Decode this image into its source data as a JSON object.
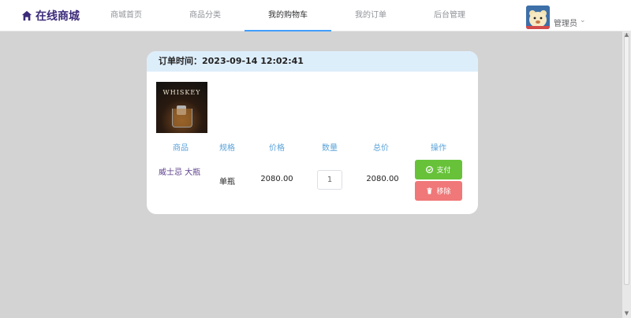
{
  "brand": {
    "name": "在线商城",
    "icon": "home-icon"
  },
  "nav": {
    "items": [
      {
        "label": "商城首页",
        "active": false
      },
      {
        "label": "商品分类",
        "active": false
      },
      {
        "label": "我的购物车",
        "active": true
      },
      {
        "label": "我的订单",
        "active": false
      },
      {
        "label": "后台管理",
        "active": false
      }
    ]
  },
  "user": {
    "name": "管理员",
    "caret": "⌄"
  },
  "order": {
    "header": "订单时间：2023-09-14 12:02:41",
    "image_text": "WHISKEY",
    "columns": [
      "商品",
      "规格",
      "价格",
      "数量",
      "总价",
      "操作"
    ],
    "item": {
      "name": "威士忌 大瓶",
      "spec": "单瓶",
      "price": "2080.00",
      "quantity": "1",
      "total": "2080.00"
    },
    "actions": {
      "pay": "支付",
      "remove": "移除"
    }
  },
  "colors": {
    "accent": "#409eff",
    "brand": "#3c2a7a",
    "pay": "#67c23a",
    "remove": "#f07878",
    "column_header": "#5aa3d9",
    "card_header": "#ddeefb"
  }
}
